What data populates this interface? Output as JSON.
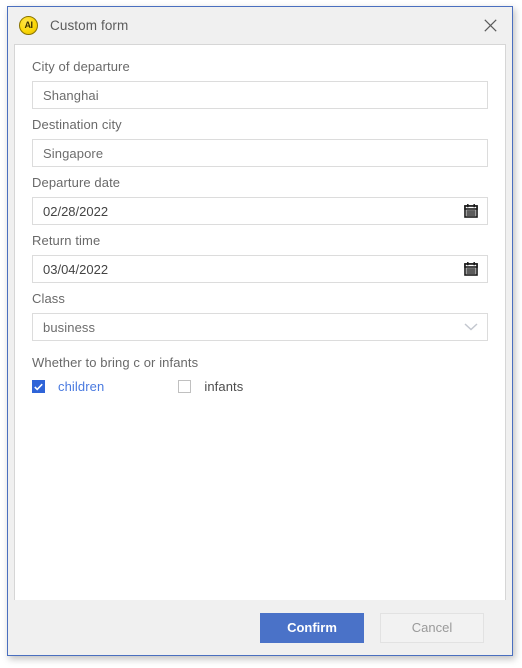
{
  "window": {
    "title": "Custom form",
    "app_icon": "ai-badge-icon",
    "close_icon": "close-icon",
    "accent_color": "#4a6fbf"
  },
  "form": {
    "fields": [
      {
        "label": "City of departure",
        "value": "Shanghai",
        "type": "text",
        "name": "city-of-departure"
      },
      {
        "label": "Destination city",
        "value": "Singapore",
        "type": "text",
        "name": "destination-city"
      },
      {
        "label": "Departure date",
        "value": "02/28/2022",
        "type": "date",
        "icon": "calendar-icon",
        "name": "departure-date"
      },
      {
        "label": "Return time",
        "value": "03/04/2022",
        "type": "date",
        "icon": "calendar-icon",
        "name": "return-time"
      },
      {
        "label": "Class",
        "value": "business",
        "type": "select",
        "icon": "chevron-down-icon",
        "name": "class"
      }
    ],
    "checkbox_group": {
      "label": "Whether to bring c or infants",
      "options": [
        {
          "label": "children",
          "checked": true
        },
        {
          "label": "infants",
          "checked": false
        }
      ]
    }
  },
  "footer": {
    "confirm_label": "Confirm",
    "cancel_label": "Cancel",
    "confirm_color": "#4a72c8",
    "cancel_color": "#f2f2f2"
  }
}
